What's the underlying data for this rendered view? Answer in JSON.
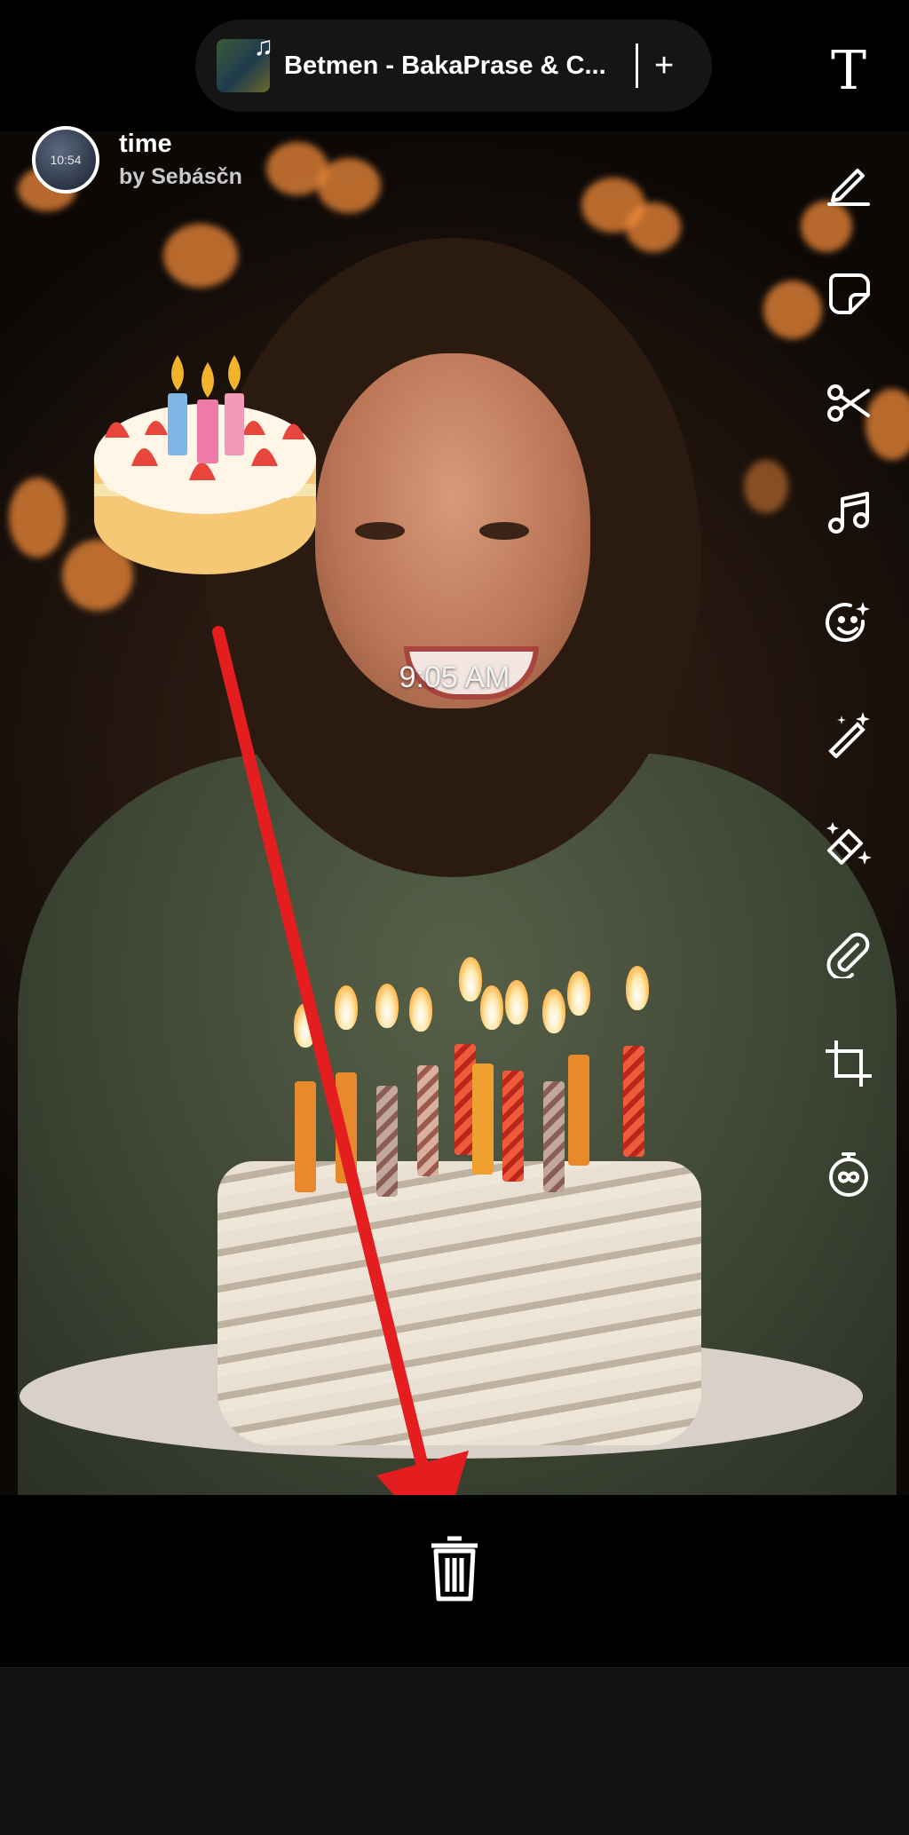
{
  "music": {
    "song_title": "Betmen - BakaPrase & C...",
    "add_label": "+"
  },
  "creator": {
    "avatar_time": "10:54",
    "name": "time",
    "byline": "by Sebásčn"
  },
  "sticker": {
    "time_text": "9:05 AM"
  },
  "toolbar": {
    "text_label": "T"
  },
  "colors": {
    "arrow": "#e41e1e",
    "background": "#000000",
    "bottom_panel": "#121212"
  }
}
